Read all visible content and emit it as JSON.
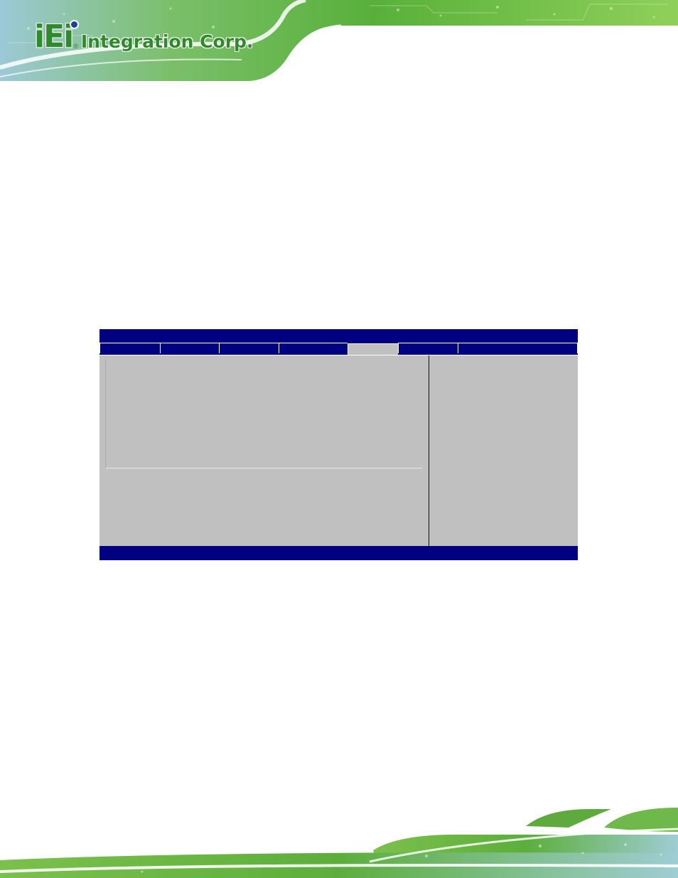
{
  "header": {
    "logo_mark": "iEi",
    "logo_reg": "®",
    "logo_text": "Integration Corp."
  },
  "colors": {
    "brand_green": "#2f8a2b",
    "bios_blue": "#000080",
    "bios_gray": "#c0c0c0"
  },
  "bios": {
    "title": "",
    "tabs": [
      {
        "label": "",
        "active": false
      },
      {
        "label": "",
        "active": false
      },
      {
        "label": "",
        "active": false
      },
      {
        "label": "",
        "active": false
      },
      {
        "label": "",
        "active": true
      },
      {
        "label": "",
        "active": false
      },
      {
        "label": "",
        "active": false
      }
    ],
    "status": ""
  }
}
